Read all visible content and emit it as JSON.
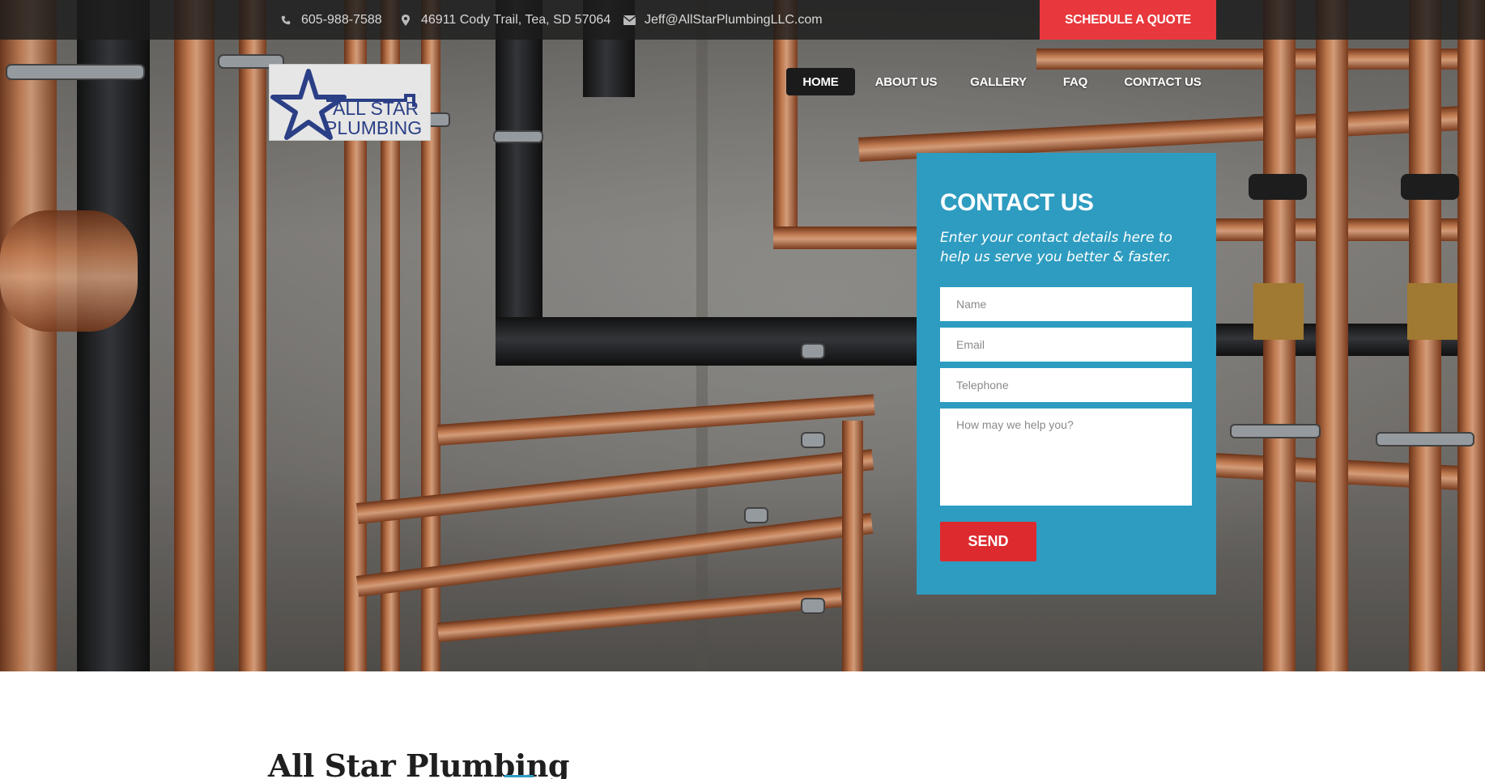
{
  "topbar": {
    "phone": "605-988-7588",
    "address": "46911 Cody Trail, Tea, SD 57064",
    "email": "Jeff@AllStarPlumbingLLC.com",
    "quote_button": "SCHEDULE A QUOTE"
  },
  "logo": {
    "line1": "ALL STAR",
    "line2": "PLUMBING"
  },
  "nav": {
    "items": [
      {
        "label": "HOME"
      },
      {
        "label": "ABOUT US"
      },
      {
        "label": "GALLERY"
      },
      {
        "label": "FAQ"
      },
      {
        "label": "CONTACT US"
      }
    ]
  },
  "contact": {
    "title": "CONTACT US",
    "subtitle": "Enter your contact details here to help us serve you better & faster.",
    "name_placeholder": "Name",
    "email_placeholder": "Email",
    "phone_placeholder": "Telephone",
    "message_placeholder": "How may we help you?",
    "send_label": "SEND"
  },
  "main": {
    "title": "All Star Plumbing"
  },
  "colors": {
    "accent_blue": "#2e9cc0",
    "accent_red": "#e8383d",
    "send_red": "#dc2a2e",
    "topbar_bg": "#1c1c1c",
    "copper": "#c8784a"
  }
}
